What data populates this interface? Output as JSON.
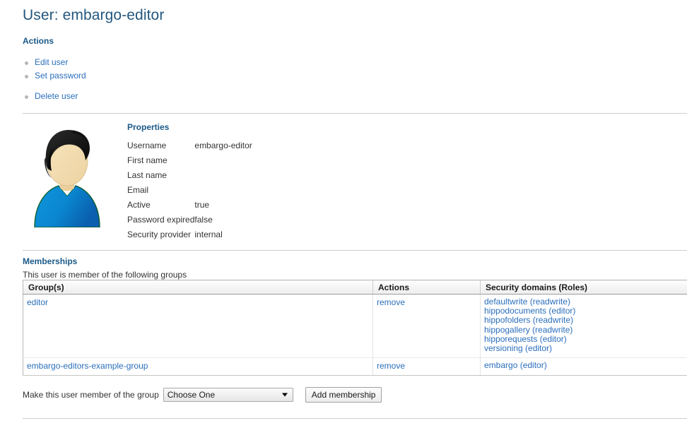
{
  "page": {
    "title": "User: embargo-editor"
  },
  "actions": {
    "heading": "Actions",
    "items": [
      {
        "label": "Edit user",
        "spaced": false
      },
      {
        "label": "Set password",
        "spaced": false
      },
      {
        "label": "Delete user",
        "spaced": true
      }
    ]
  },
  "properties": {
    "heading": "Properties",
    "rows": [
      {
        "label": "Username",
        "value": "embargo-editor"
      },
      {
        "label": "First name",
        "value": ""
      },
      {
        "label": "Last name",
        "value": ""
      },
      {
        "label": "Email",
        "value": ""
      },
      {
        "label": "Active",
        "value": "true"
      },
      {
        "label": "Password expired",
        "value": "false"
      },
      {
        "label": "Security provider",
        "value": "internal"
      }
    ]
  },
  "memberships": {
    "heading": "Memberships",
    "subtitle": "This user is member of the following groups",
    "columns": [
      "Group(s)",
      "Actions",
      "Security domains (Roles)"
    ],
    "rows": [
      {
        "group": "editor",
        "action": "remove",
        "domains": [
          "defaultwrite (readwrite)",
          "hippodocuments (editor)",
          "hippofolders (readwrite)",
          "hippogallery (readwrite)",
          "hipporequests (editor)",
          "versioning (editor)"
        ]
      },
      {
        "group": "embargo-editors-example-group",
        "action": "remove",
        "domains": [
          "embargo (editor)"
        ]
      }
    ]
  },
  "add_membership_form": {
    "label": "Make this user member of the group",
    "select_value": "Choose One",
    "button_label": "Add membership"
  },
  "colors": {
    "title": "#23577f",
    "heading": "#1b5a89",
    "link": "#2a6ebb",
    "text": "#333333",
    "divider": "#cfcfcf",
    "avatar_shirt": "#0b8fd4",
    "avatar_hair": "#1b1b1b",
    "avatar_skin": "#f3d9a8"
  },
  "icons": {
    "avatar": "user-avatar-icon",
    "bullet": "bullet-dot-icon",
    "select_arrow": "chevron-down-icon"
  }
}
